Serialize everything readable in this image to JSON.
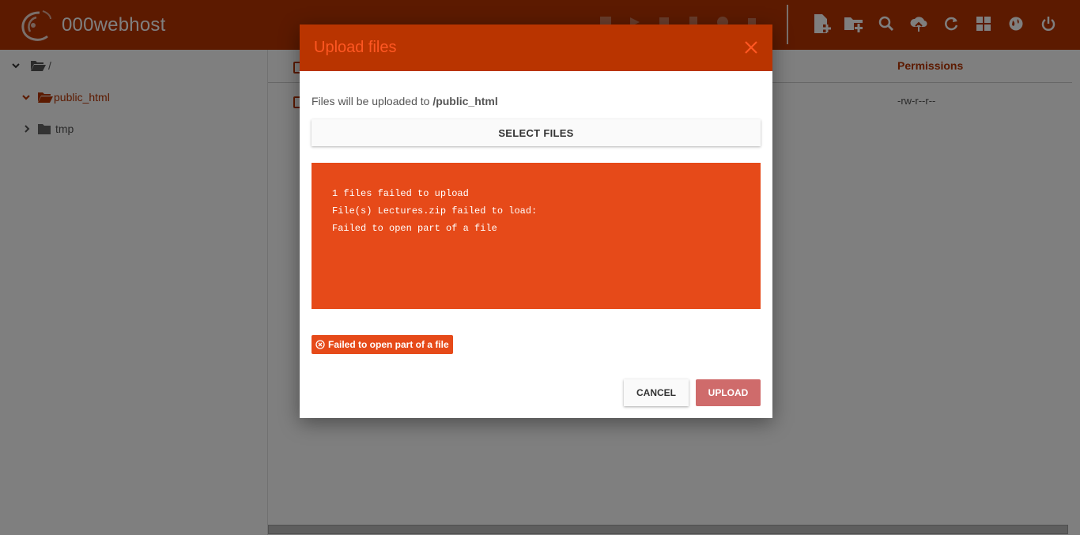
{
  "app": {
    "brand": "000webhost"
  },
  "toolbar": {
    "icons": [
      "new-file-icon",
      "new-folder-icon",
      "search-icon",
      "upload-icon",
      "refresh-icon",
      "grid-view-icon",
      "globe-icon",
      "power-icon"
    ]
  },
  "tree": {
    "root_label": "/",
    "items": [
      {
        "label": "public_html",
        "state": "open",
        "selected": true
      },
      {
        "label": "tmp",
        "state": "collapsed",
        "selected": false
      }
    ]
  },
  "table": {
    "columns": [
      "Permissions"
    ],
    "rows": [
      {
        "permissions": "-rw-r--r--"
      }
    ]
  },
  "modal": {
    "title": "Upload files",
    "destination_prefix": "Files will be uploaded to ",
    "destination_path": "/public_html",
    "select_label": "SELECT FILES",
    "error_lines": [
      "1 files failed to upload",
      "File(s) Lectures.zip failed to load:",
      "Failed to open part of a file"
    ],
    "error_badge": "Failed to open part of a file",
    "cancel_label": "CANCEL",
    "upload_label": "UPLOAD"
  },
  "colors": {
    "brand": "#b93400",
    "accent": "#ff5722",
    "error": "#e64a19",
    "upload_disabled": "#cf6b6b"
  }
}
